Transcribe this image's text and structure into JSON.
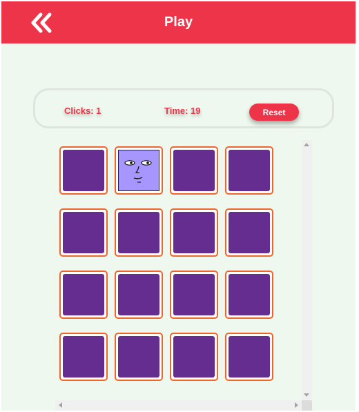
{
  "header": {
    "title": "Play",
    "back_icon": "double-chevron-left-icon"
  },
  "stats": {
    "clicks_label": "Clicks: 1",
    "time_label": "Time: 19",
    "reset_label": "Reset"
  },
  "board": {
    "rows": 4,
    "cols": 4,
    "flipped_index": 1,
    "flipped_icon": "face-icon"
  },
  "colors": {
    "accent": "#ee3448",
    "background": "#eff8ee",
    "card_back": "#662d91",
    "card_border": "#f0652c",
    "card_face": "#a796fd"
  }
}
